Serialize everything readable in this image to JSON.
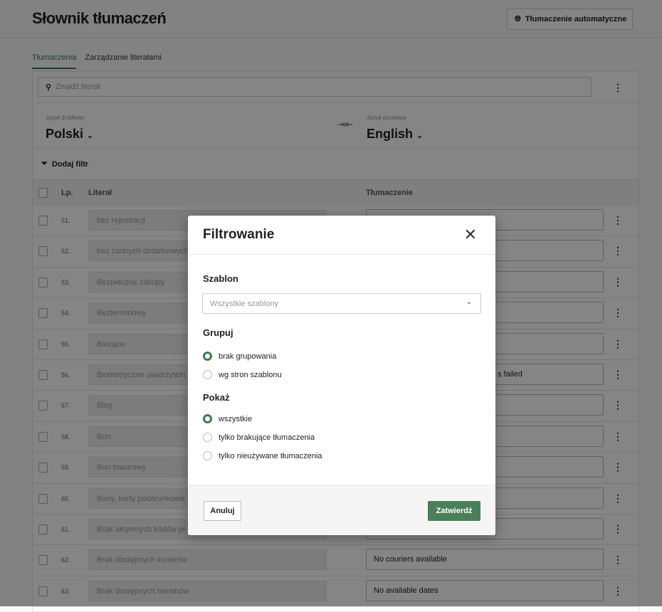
{
  "header": {
    "title": "Słownik tłumaczeń",
    "auto_translate_label": "Tłumaczenie automatyczne"
  },
  "tabs": [
    {
      "label": "Tłumaczenia",
      "active": true
    },
    {
      "label": "Zarządzanie literałami",
      "active": false
    }
  ],
  "search": {
    "placeholder": "Znajdź literał"
  },
  "languages": {
    "source_label": "Język źródłowy",
    "source_value": "Polski",
    "target_label": "Język docelowy",
    "target_value": "English"
  },
  "filter": {
    "add_label": "Dodaj filtr"
  },
  "table": {
    "columns": {
      "lp": "Lp.",
      "literal": "Literał",
      "translation": "Tłumaczenie"
    },
    "rows": [
      {
        "lp": "51.",
        "literal": "bez rejestracji",
        "translation": ""
      },
      {
        "lp": "52.",
        "literal": "bez żadnych dodatkowych",
        "translation": ""
      },
      {
        "lp": "53.",
        "literal": "Bezpieczne zakupy",
        "translation": ""
      },
      {
        "lp": "54.",
        "literal": "Bezterminowy",
        "translation": ""
      },
      {
        "lp": "55.",
        "literal": "Bieżące",
        "translation": ""
      },
      {
        "lp": "56.",
        "literal": "Biometryczne uwierzyteln",
        "translation": "s failed"
      },
      {
        "lp": "57.",
        "literal": "Blog",
        "translation": ""
      },
      {
        "lp": "58.",
        "literal": "Bon",
        "translation": ""
      },
      {
        "lp": "59.",
        "literal": "Bon towarowy",
        "translation": ""
      },
      {
        "lp": "60.",
        "literal": "Bony, karty podarunkowe",
        "translation": ""
      },
      {
        "lp": "61.",
        "literal": "Brak aktywnych kodów pr",
        "translation": ""
      },
      {
        "lp": "62.",
        "literal": "Brak dostępnych kurierów",
        "translation": "No couriers available"
      },
      {
        "lp": "63.",
        "literal": "Brak dostępnych terminów",
        "translation": "No available dates"
      }
    ]
  },
  "modal": {
    "title": "Filtrowanie",
    "template_label": "Szablon",
    "template_select": "Wszystkie szablony",
    "group_label": "Grupuj",
    "group_options": [
      {
        "label": "brak grupowania",
        "checked": true
      },
      {
        "label": "wg stron szablonu",
        "checked": false
      }
    ],
    "show_label": "Pokaż",
    "show_options": [
      {
        "label": "wszystkie",
        "checked": true
      },
      {
        "label": "tylko brakujące tłumaczenia",
        "checked": false
      },
      {
        "label": "tylko nieużywane tłumaczenia",
        "checked": false
      }
    ],
    "cancel_label": "Anuluj",
    "confirm_label": "Zatwierdź"
  },
  "colors": {
    "accent": "#4a7f59"
  }
}
